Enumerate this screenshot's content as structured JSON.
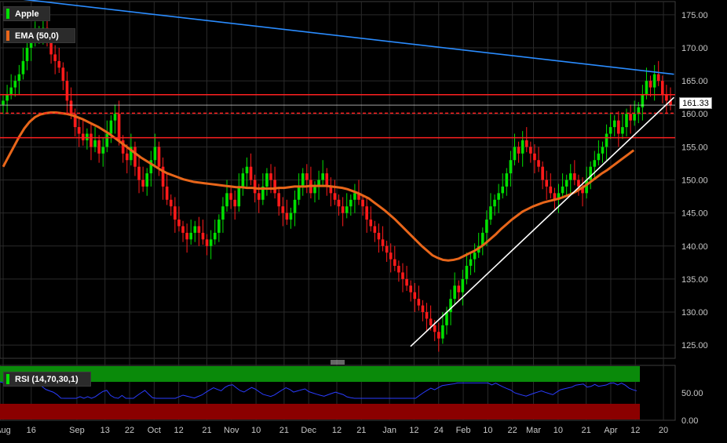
{
  "chart_data": [
    {
      "type": "candlestick",
      "name": "Apple",
      "overlay_label": "EMA (50,0)",
      "colors": {
        "up": "#00e000",
        "down": "#ff1a1a",
        "ema": "#e8661a",
        "trend_down": "#2a8cff",
        "trend_up": "#ffffff",
        "hline": "#ff2020",
        "grid": "#2a2a2a",
        "axis_text": "#c8c8c8"
      },
      "ylim": [
        123,
        177
      ],
      "y_ticks": [
        "125.00",
        "130.00",
        "135.00",
        "140.00",
        "145.00",
        "150.00",
        "155.00",
        "160.00",
        "165.00",
        "170.00",
        "175.00"
      ],
      "y_tick_values": [
        125,
        130,
        135,
        140,
        145,
        150,
        155,
        160,
        165,
        170,
        175
      ],
      "last_price": "161.33",
      "last_price_value": 161.33,
      "x_ticks": [
        {
          "label": "Aug",
          "i": 0
        },
        {
          "label": "16",
          "i": 8
        },
        {
          "label": "Sep",
          "i": 21
        },
        {
          "label": "13",
          "i": 29
        },
        {
          "label": "22",
          "i": 36
        },
        {
          "label": "Oct",
          "i": 43
        },
        {
          "label": "12",
          "i": 50
        },
        {
          "label": "21",
          "i": 58
        },
        {
          "label": "Nov",
          "i": 65
        },
        {
          "label": "10",
          "i": 72
        },
        {
          "label": "21",
          "i": 80
        },
        {
          "label": "Dec",
          "i": 87
        },
        {
          "label": "12",
          "i": 95
        },
        {
          "label": "21",
          "i": 102
        },
        {
          "label": "Jan",
          "i": 110
        },
        {
          "label": "12",
          "i": 117
        },
        {
          "label": "24",
          "i": 124
        },
        {
          "label": "Feb",
          "i": 131
        },
        {
          "label": "10",
          "i": 138
        },
        {
          "label": "22",
          "i": 145
        },
        {
          "label": "Mar",
          "i": 151
        },
        {
          "label": "10",
          "i": 158
        },
        {
          "label": "21",
          "i": 166
        },
        {
          "label": "Apr",
          "i": 173
        },
        {
          "label": "12",
          "i": 180
        },
        {
          "label": "20",
          "i": 188
        }
      ],
      "x_count": 191,
      "closes": [
        162,
        163,
        164,
        165,
        166,
        168,
        170,
        171,
        172,
        172.5,
        173,
        171,
        169,
        168,
        167,
        165,
        162,
        160,
        158,
        157,
        156,
        157,
        155,
        156,
        154,
        155,
        157,
        159,
        160,
        156,
        154,
        153,
        155,
        152,
        150,
        149,
        151,
        153,
        155,
        152,
        149,
        147,
        146,
        144,
        143,
        142,
        141,
        142,
        143,
        142,
        141,
        140,
        141,
        142,
        144,
        146,
        148,
        147,
        146,
        149,
        151,
        152,
        150,
        148,
        147,
        149,
        151,
        150,
        148,
        146,
        145,
        144,
        145,
        147,
        149,
        151,
        150,
        148,
        149,
        150,
        151,
        149,
        148,
        147,
        146,
        145,
        146,
        147,
        148,
        147,
        146,
        144,
        143,
        142,
        141,
        140,
        139,
        138,
        137,
        136,
        135,
        134,
        133,
        132,
        131,
        130,
        129,
        128,
        127,
        126,
        128,
        130,
        132,
        134,
        133,
        135,
        137,
        138,
        139,
        140,
        142,
        144,
        146,
        147,
        148,
        149,
        151,
        153,
        155,
        154,
        156,
        155,
        154,
        153,
        152,
        150,
        149,
        148,
        147,
        148,
        149,
        150,
        151,
        150,
        149,
        148,
        150,
        152,
        153,
        154,
        155,
        157,
        158,
        159,
        157,
        158,
        160,
        159,
        160,
        161,
        163,
        165,
        164,
        166,
        165,
        163,
        162,
        161.33
      ],
      "ema": [
        152,
        153.5,
        155,
        156.5,
        157.8,
        158.8,
        159.5,
        159.9,
        160.1,
        160.2,
        160.2,
        160.1,
        160,
        159.8,
        159.5,
        159.2,
        158.8,
        158.4,
        158,
        157.5,
        157,
        156.4,
        155.8,
        155.2,
        154.6,
        154,
        153.4,
        152.9,
        152.4,
        151.9,
        151.4,
        151,
        150.7,
        150.4,
        150.1,
        149.9,
        149.7,
        149.6,
        149.5,
        149.4,
        149.3,
        149.2,
        149.1,
        149,
        148.9,
        148.9,
        148.8,
        148.8,
        148.7,
        148.7,
        148.7,
        148.7,
        148.8,
        148.8,
        148.9,
        149,
        149,
        149,
        149.1,
        149.1,
        149.1,
        149.1,
        149,
        148.9,
        148.8,
        148.6,
        148.3,
        148,
        147.6,
        147.2,
        146.6,
        146,
        145.4,
        144.7,
        144,
        143.2,
        142.4,
        141.6,
        140.8,
        140,
        139.3,
        138.6,
        138.2,
        137.9,
        137.8,
        137.9,
        138.1,
        138.5,
        138.9,
        139.3,
        139.8,
        140.4,
        141.1,
        141.8,
        142.6,
        143.3,
        144,
        144.6,
        145.2,
        145.6,
        146,
        146.3,
        146.6,
        146.8,
        147,
        147.2,
        147.5,
        147.8,
        148.2,
        148.7,
        149.2,
        149.8,
        150.4,
        151,
        151.5,
        152.1,
        152.7,
        153.3,
        153.9,
        154.5
      ],
      "ema_start": 0,
      "h_lines": [
        162.9,
        160.1,
        156.4
      ],
      "h_lines_dashed": [
        false,
        true,
        false
      ],
      "trendline_down": [
        [
          3,
          177.5
        ],
        [
          191,
          166
        ]
      ],
      "trendline_up": [
        [
          116,
          124.8
        ],
        [
          191,
          162.5
        ]
      ]
    },
    {
      "type": "line",
      "name": "RSI (14,70,30,1)",
      "ylim": [
        0,
        100
      ],
      "y_ticks": [
        "50.00",
        "0.00"
      ],
      "y_tick_values": [
        50,
        0
      ],
      "overbought": 70,
      "oversold": 30,
      "colors": {
        "line": "#2a3cff",
        "over": "#0a8a0a",
        "under": "#8b0000"
      }
    }
  ]
}
